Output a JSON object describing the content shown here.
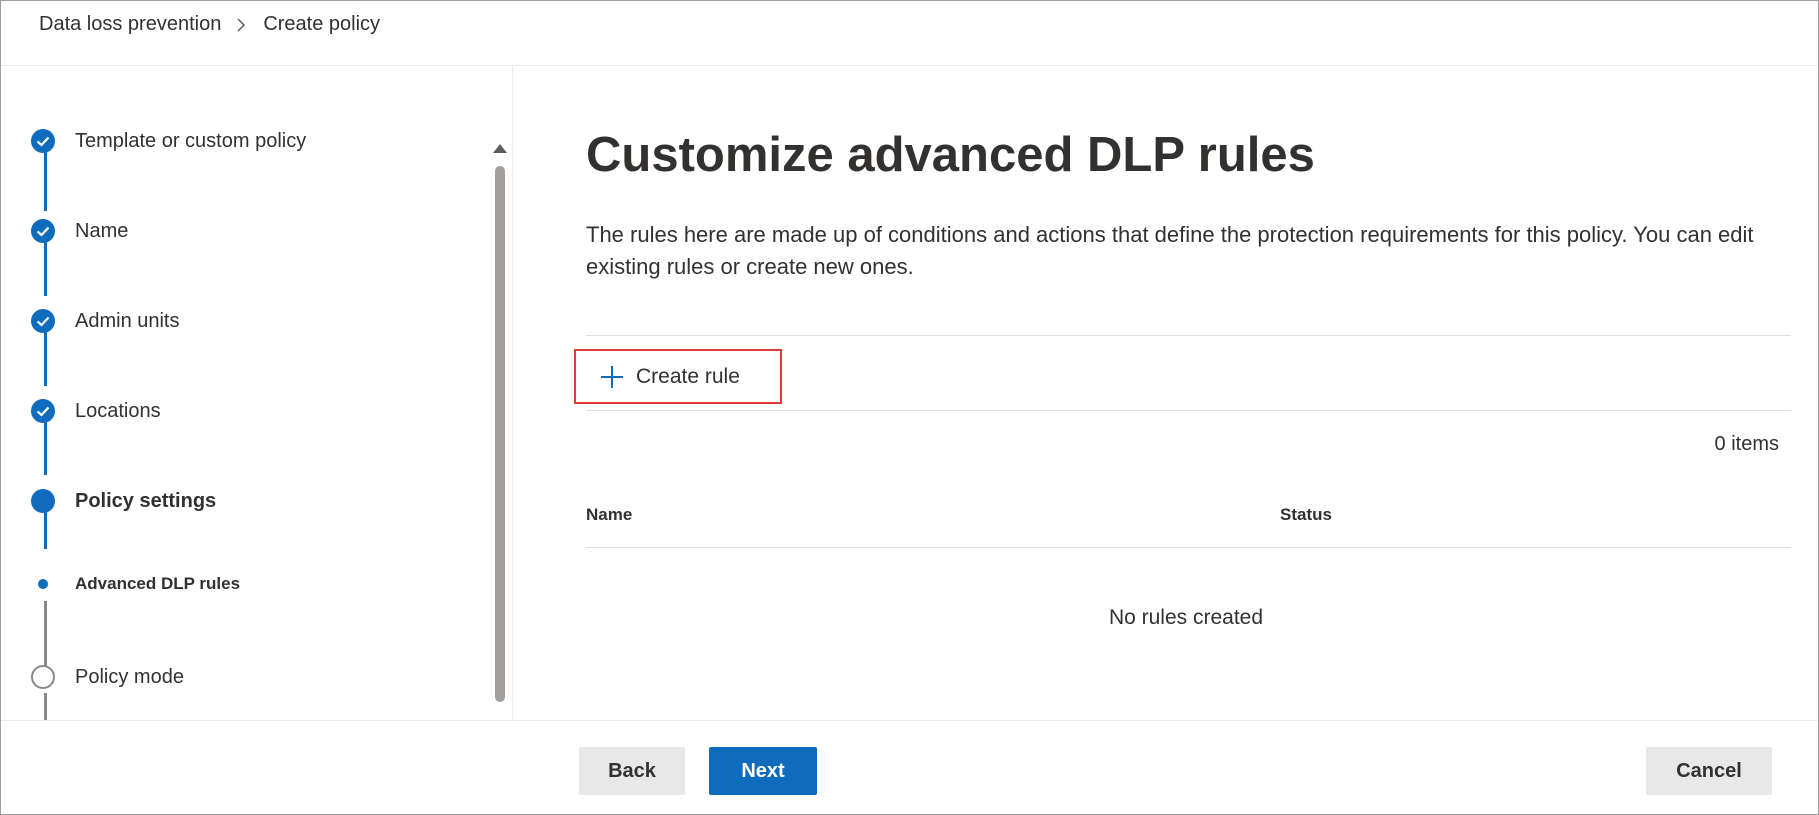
{
  "breadcrumb": {
    "items": [
      "Data loss prevention",
      "Create policy"
    ]
  },
  "steps": [
    {
      "label": "Template or custom policy",
      "state": "done"
    },
    {
      "label": "Name",
      "state": "done"
    },
    {
      "label": "Admin units",
      "state": "done"
    },
    {
      "label": "Locations",
      "state": "done"
    },
    {
      "label": "Policy settings",
      "state": "current"
    },
    {
      "label": "Advanced DLP rules",
      "state": "current-substep"
    },
    {
      "label": "Policy mode",
      "state": "todo"
    }
  ],
  "main": {
    "title": "Customize advanced DLP rules",
    "description": "The rules here are made up of conditions and actions that define the protection requirements for this policy. You can edit existing rules or create new ones.",
    "create_rule_label": "Create rule",
    "item_count": "0 items",
    "columns": [
      "Name",
      "Status"
    ],
    "empty_text": "No rules created"
  },
  "footer": {
    "back_label": "Back",
    "next_label": "Next",
    "cancel_label": "Cancel"
  },
  "colors": {
    "accent": "#0f6cbd",
    "highlight_border": "#e03b3b",
    "todo_gray": "#8a8886"
  }
}
